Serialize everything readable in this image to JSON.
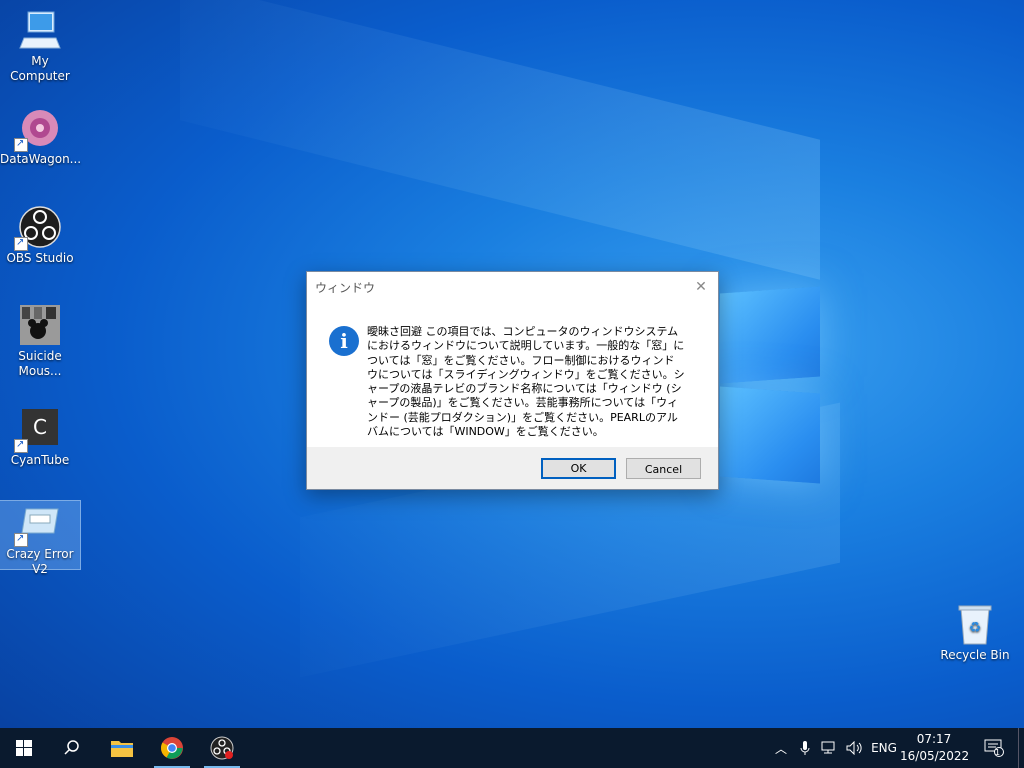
{
  "desktop": {
    "icons": [
      {
        "label": "My Computer",
        "name": "my-computer-icon"
      },
      {
        "label": "DataWagon...",
        "name": "datawagon-icon"
      },
      {
        "label": "OBS Studio",
        "name": "obs-studio-icon"
      },
      {
        "label": "Suicide Mous...",
        "name": "suicide-mouse-icon"
      },
      {
        "label": "CyanTube",
        "name": "cyantube-icon",
        "glyph": "C"
      },
      {
        "label": "Crazy Error V2",
        "name": "crazy-error-icon"
      },
      {
        "label": "Recycle Bin",
        "name": "recycle-bin-icon"
      }
    ]
  },
  "dialog": {
    "title": "ウィンドウ",
    "message": "曖昧さ回避 この項目では、コンピュータのウィンドウシステムにおけるウィンドウについて説明しています。一般的な「窓」については「窓」をご覧ください。フロー制御におけるウィンドウについては「スライディングウィンドウ」をご覧ください。シャープの液晶テレビのブランド名称については「ウィンドウ (シャープの製品)」をご覧ください。芸能事務所については「ウィンドー (芸能プロダクション)」をご覧ください。PEARLのアルバムについては「WINDOW」をご覧ください。",
    "ok_label": "OK",
    "cancel_label": "Cancel",
    "icon": "info-icon"
  },
  "taskbar": {
    "language": "ENG",
    "time": "07:17",
    "date": "16/05/2022",
    "notification_count": "1",
    "apps": [
      "start",
      "search",
      "file-explorer",
      "chrome",
      "obs-studio"
    ]
  },
  "colors": {
    "accent": "#1a70d0",
    "taskbar": "#0a1a2e",
    "desktop": "#0a5dcc"
  }
}
